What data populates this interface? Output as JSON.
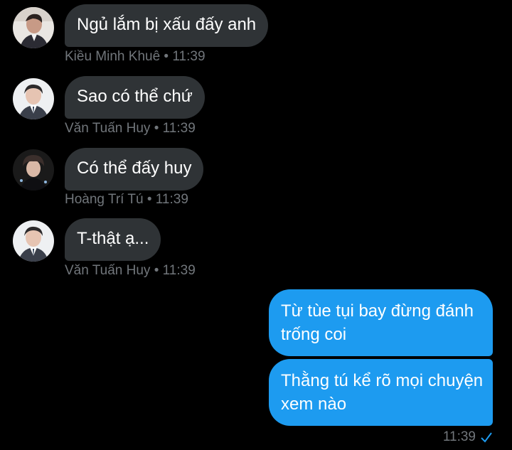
{
  "messages": [
    {
      "text": "Ngủ lắm bị xấu đấy anh",
      "sender": "Kiều Minh Khuê",
      "time": "11:39",
      "avatar": "avatar-khue"
    },
    {
      "text": "Sao có thể chứ",
      "sender": "Văn Tuấn Huy",
      "time": "11:39",
      "avatar": "avatar-huy"
    },
    {
      "text": "Có thể đấy huy",
      "sender": "Hoàng Trí Tú",
      "time": "11:39",
      "avatar": "avatar-tu"
    },
    {
      "text": "T-thật ạ...",
      "sender": "Văn Tuấn Huy",
      "time": "11:39",
      "avatar": "avatar-huy"
    }
  ],
  "outgoing": [
    {
      "text": "Từ tùe tụi bay đừng đánh trống coi"
    },
    {
      "text": "Thằng tú kể rõ mọi chuyện xem nào"
    }
  ],
  "outgoing_time": "11:39",
  "separator": " • ",
  "colors": {
    "incoming_bubble": "#2f3336",
    "outgoing_bubble": "#1d9bf0",
    "meta_text": "#71767b",
    "background": "#000000"
  }
}
